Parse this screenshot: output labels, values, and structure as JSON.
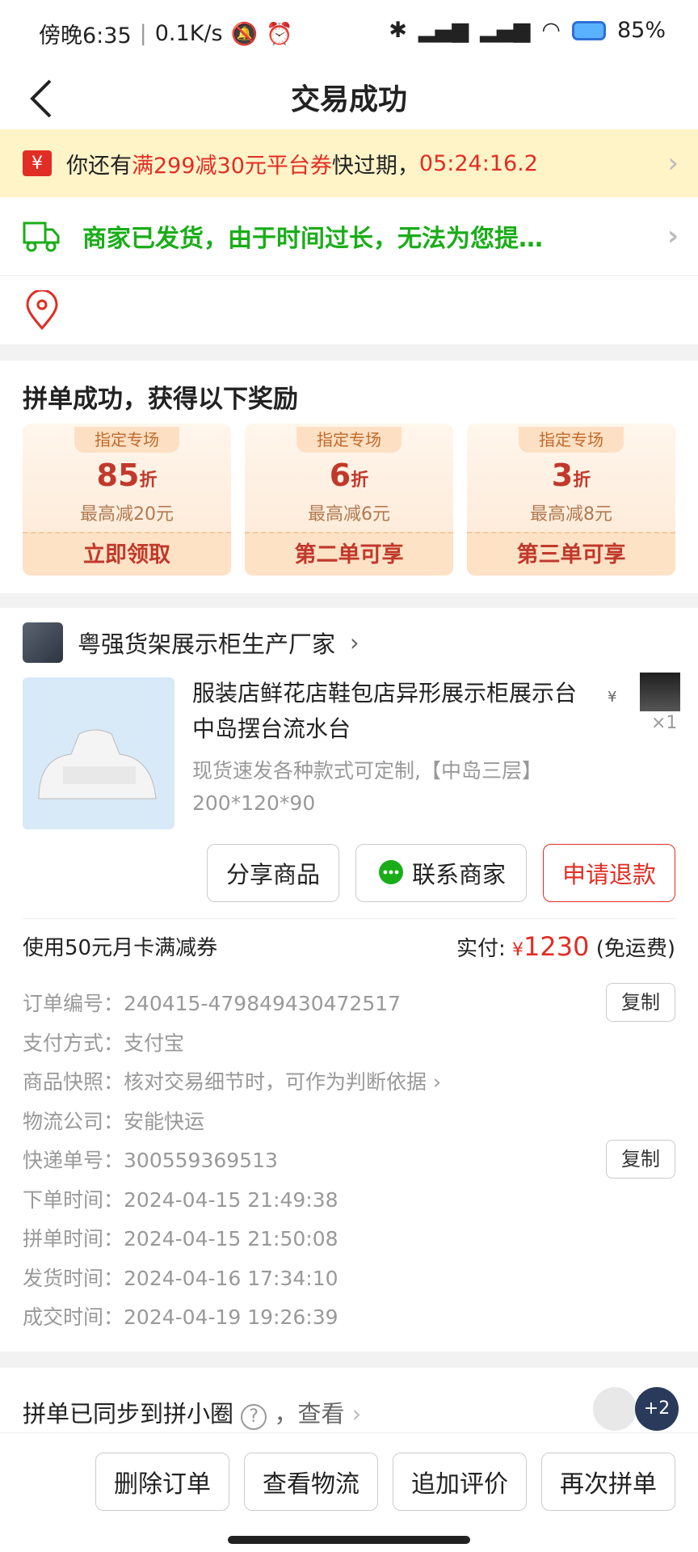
{
  "status_bar": {
    "time": "傍晚6:35",
    "speed": "0.1K/s",
    "battery": "85%"
  },
  "nav": {
    "title": "交易成功"
  },
  "coupon_banner": {
    "prefix": "你还有",
    "highlight": "满299减30元平台券",
    "mid": "快过期，",
    "countdown": "05:24:16.2"
  },
  "shipping": {
    "text": "商家已发货，由于时间过长，无法为您提…"
  },
  "reward": {
    "title": "拼单成功，获得以下奖励",
    "cards": [
      {
        "tag": "指定专场",
        "discount": "85",
        "unit": "折",
        "max": "最高减20元",
        "action": "立即领取"
      },
      {
        "tag": "指定专场",
        "discount": "6",
        "unit": "折",
        "max": "最高减6元",
        "action": "第二单可享"
      },
      {
        "tag": "指定专场",
        "discount": "3",
        "unit": "折",
        "max": "最高减8元",
        "action": "第三单可享"
      }
    ]
  },
  "order": {
    "shop_name": "粤强货架展示柜生产厂家",
    "product_title": "服装店鲜花店鞋包店异形展示柜展示台中岛摆台流水台",
    "product_spec": "现货速发各种款式可定制,【中岛三层】200*120*90",
    "quantity": "×1",
    "price_symbol": "¥",
    "buttons": {
      "share": "分享商品",
      "contact": "联系商家",
      "refund": "申请退款"
    },
    "coupon_used": "使用50元月卡满减券",
    "paid_label": "实付:",
    "paid_currency": "¥",
    "paid_amount": "1230",
    "shipping_fee": "(免运费)",
    "copy_label": "复制",
    "details": [
      {
        "key": "订单编号：",
        "value": "240415-479849430472517"
      },
      {
        "key": "支付方式：",
        "value": "支付宝"
      },
      {
        "key": "商品快照：",
        "value": "核对交易细节时，可作为判断依据"
      },
      {
        "key": "物流公司：",
        "value": "安能快运"
      },
      {
        "key": "快递单号：",
        "value": "300559369513"
      },
      {
        "key": "下单时间：",
        "value": "2024-04-15  21:49:38"
      },
      {
        "key": "拼单时间：",
        "value": "2024-04-15  21:50:08"
      },
      {
        "key": "发货时间：",
        "value": "2024-04-16  17:34:10"
      },
      {
        "key": "成交时间：",
        "value": "2024-04-19  19:26:39"
      }
    ]
  },
  "sync": {
    "text": "拼单已同步到拼小圈",
    "view": "，查看",
    "count": "+2"
  },
  "bottom_buttons": {
    "delete": "删除订单",
    "logistics": "查看物流",
    "review": "追加评价",
    "rebuy": "再次拼单"
  }
}
